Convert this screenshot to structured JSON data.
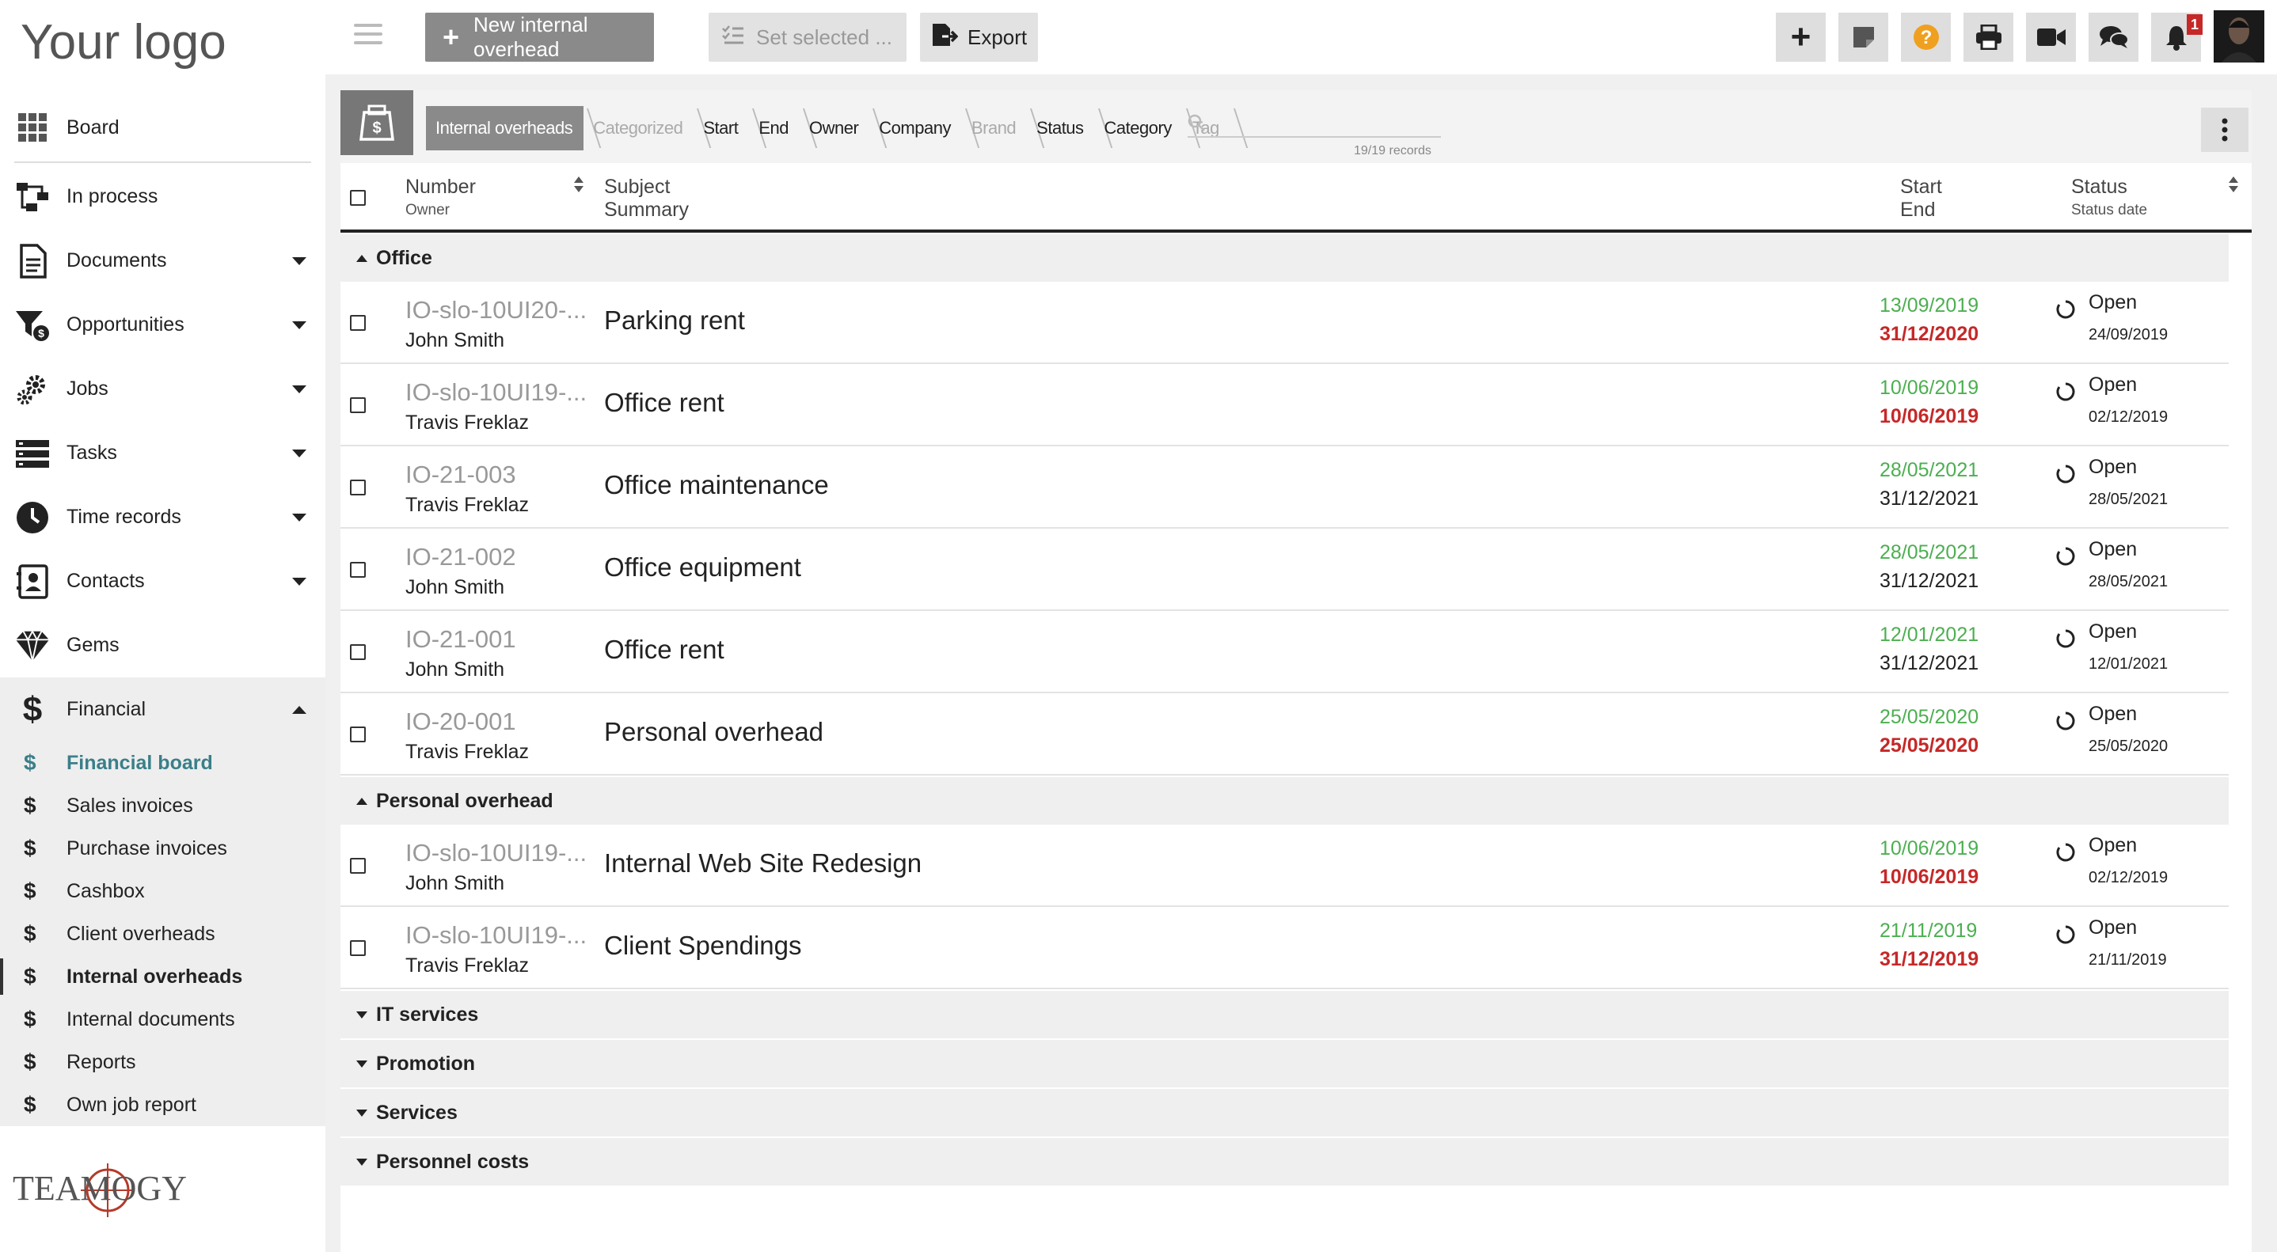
{
  "sidebar": {
    "logo": "Your logo",
    "nav": [
      {
        "label": "Board"
      },
      {
        "label": "In process"
      },
      {
        "label": "Documents"
      },
      {
        "label": "Opportunities"
      },
      {
        "label": "Jobs"
      },
      {
        "label": "Tasks"
      },
      {
        "label": "Time records"
      },
      {
        "label": "Contacts"
      },
      {
        "label": "Gems"
      },
      {
        "label": "Financial"
      }
    ],
    "financial_items": [
      {
        "label": "Financial board"
      },
      {
        "label": "Sales invoices"
      },
      {
        "label": "Purchase invoices"
      },
      {
        "label": "Cashbox"
      },
      {
        "label": "Client overheads"
      },
      {
        "label": "Internal overheads"
      },
      {
        "label": "Internal documents"
      },
      {
        "label": "Reports"
      },
      {
        "label": "Own job report"
      }
    ],
    "brand": "TEAMOGY"
  },
  "toolbar": {
    "new_label": "New internal overhead",
    "set_label": "Set selected ...",
    "export_label": "Export",
    "notification_count": "1"
  },
  "filterbar": {
    "crumbs": [
      "Internal overheads",
      "Categorized",
      "Start",
      "End",
      "Owner",
      "Company",
      "Brand",
      "Status",
      "Category",
      "Tag"
    ],
    "records": "19/19 records"
  },
  "table": {
    "headers": {
      "number": "Number",
      "owner": "Owner",
      "subject": "Subject",
      "summary": "Summary",
      "start": "Start",
      "end": "End",
      "status": "Status",
      "status_date": "Status date"
    },
    "groups": [
      {
        "name": "Office",
        "expanded": true,
        "rows": [
          {
            "number": "IO-slo-10UI20-...",
            "owner": "John Smith",
            "subject": "Parking rent",
            "start": "13/09/2019",
            "end": "31/12/2020",
            "end_overdue": true,
            "status": "Open",
            "status_date": "24/09/2019"
          },
          {
            "number": "IO-slo-10UI19-...",
            "owner": "Travis Freklaz",
            "subject": "Office rent",
            "start": "10/06/2019",
            "end": "10/06/2019",
            "end_overdue": true,
            "status": "Open",
            "status_date": "02/12/2019"
          },
          {
            "number": "IO-21-003",
            "owner": "Travis Freklaz",
            "subject": "Office maintenance",
            "start": "28/05/2021",
            "end": "31/12/2021",
            "end_overdue": false,
            "status": "Open",
            "status_date": "28/05/2021"
          },
          {
            "number": "IO-21-002",
            "owner": "John Smith",
            "subject": "Office equipment",
            "start": "28/05/2021",
            "end": "31/12/2021",
            "end_overdue": false,
            "status": "Open",
            "status_date": "28/05/2021"
          },
          {
            "number": "IO-21-001",
            "owner": "John Smith",
            "subject": "Office rent",
            "start": "12/01/2021",
            "end": "31/12/2021",
            "end_overdue": false,
            "status": "Open",
            "status_date": "12/01/2021"
          },
          {
            "number": "IO-20-001",
            "owner": "Travis Freklaz",
            "subject": "Personal overhead",
            "start": "25/05/2020",
            "end": "25/05/2020",
            "end_overdue": true,
            "status": "Open",
            "status_date": "25/05/2020"
          }
        ]
      },
      {
        "name": "Personal overhead",
        "expanded": true,
        "rows": [
          {
            "number": "IO-slo-10UI19-...",
            "owner": "John Smith",
            "subject": "Internal Web Site Redesign",
            "start": "10/06/2019",
            "end": "10/06/2019",
            "end_overdue": true,
            "status": "Open",
            "status_date": "02/12/2019"
          },
          {
            "number": "IO-slo-10UI19-...",
            "owner": "Travis Freklaz",
            "subject": "Client Spendings",
            "start": "21/11/2019",
            "end": "31/12/2019",
            "end_overdue": true,
            "status": "Open",
            "status_date": "21/11/2019"
          }
        ]
      },
      {
        "name": "IT services",
        "expanded": false,
        "rows": []
      },
      {
        "name": "Promotion",
        "expanded": false,
        "rows": []
      },
      {
        "name": "Services",
        "expanded": false,
        "rows": []
      },
      {
        "name": "Personnel costs",
        "expanded": false,
        "rows": []
      }
    ]
  },
  "colors": {
    "start_date": "#4caf50",
    "overdue": "#c62828",
    "accent": "#3a7f8a",
    "help": "#f0a020"
  }
}
